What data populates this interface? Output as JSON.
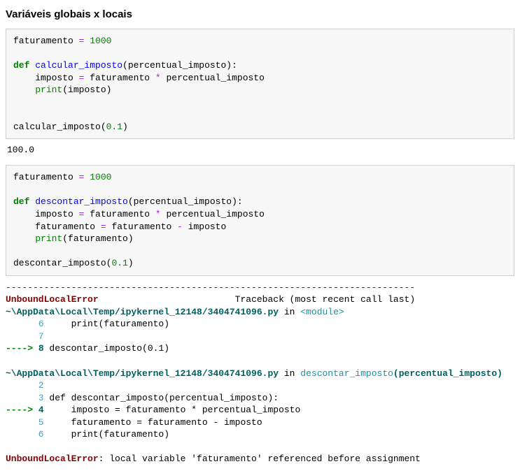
{
  "title": "Variáveis globais x locais",
  "cell1": {
    "line1_a": "faturamento ",
    "line1_b": "=",
    "line1_c": " ",
    "line1_d": "1000",
    "line2": "",
    "line3_a": "def",
    "line3_b": " ",
    "line3_c": "calcular_imposto",
    "line3_d": "(percentual_imposto):",
    "line4_a": "    imposto ",
    "line4_b": "=",
    "line4_c": " faturamento ",
    "line4_d": "*",
    "line4_e": " percentual_imposto",
    "line5_a": "    ",
    "line5_b": "print",
    "line5_c": "(imposto)",
    "line6": "",
    "line7": "",
    "line8_a": "calcular_imposto(",
    "line8_b": "0.1",
    "line8_c": ")"
  },
  "output1": "100.0",
  "cell2": {
    "line1_a": "faturamento ",
    "line1_b": "=",
    "line1_c": " ",
    "line1_d": "1000",
    "line2": "",
    "line3_a": "def",
    "line3_b": " ",
    "line3_c": "descontar_imposto",
    "line3_d": "(percentual_imposto):",
    "line4_a": "    imposto ",
    "line4_b": "=",
    "line4_c": " faturamento ",
    "line4_d": "*",
    "line4_e": " percentual_imposto",
    "line5_a": "    faturamento ",
    "line5_b": "=",
    "line5_c": " faturamento ",
    "line5_d": "-",
    "line5_e": " imposto",
    "line6_a": "    ",
    "line6_b": "print",
    "line6_c": "(faturamento)",
    "line7": "",
    "line8_a": "descontar_imposto(",
    "line8_b": "0.1",
    "line8_c": ")"
  },
  "tb": {
    "dashes": "---------------------------------------------------------------------------",
    "err_name": "UnboundLocalError",
    "err_pad": "                         ",
    "trace_label": "Traceback (most recent call last)",
    "path1": "~\\AppData\\Local\\Temp/ipykernel_12148/3404741096.py",
    "in": " in ",
    "module": "<module>",
    "f1_l6_n": "      6",
    "f1_l6_t": "     print(faturamento)",
    "f1_l7_n": "      7",
    "f1_l7_t": "",
    "arrow": "----> ",
    "f1_l8_n": "8",
    "f1_l8_t_a": " descontar_imposto(",
    "f1_l8_t_b": "0.1",
    "f1_l8_t_c": ")",
    "path2": "~\\AppData\\Local\\Temp/ipykernel_12148/3404741096.py",
    "fn2": "descontar_imposto",
    "arg2_a": "(",
    "arg2_b": "percentual_imposto",
    "arg2_c": ")",
    "f2_l2_n": "      2",
    "f2_l2_t": "",
    "f2_l3_n": "      3",
    "f2_l3_t": " def descontar_imposto(percentual_imposto):",
    "f2_l4_n": "4",
    "f2_l4_t": "     imposto = faturamento * percentual_imposto",
    "f2_l5_n": "      5",
    "f2_l5_t": "     faturamento = faturamento - imposto",
    "f2_l6_n": "      6",
    "f2_l6_t": "     print(faturamento)",
    "final_err": "UnboundLocalError",
    "final_msg": ": local variable 'faturamento' referenced before assignment"
  }
}
